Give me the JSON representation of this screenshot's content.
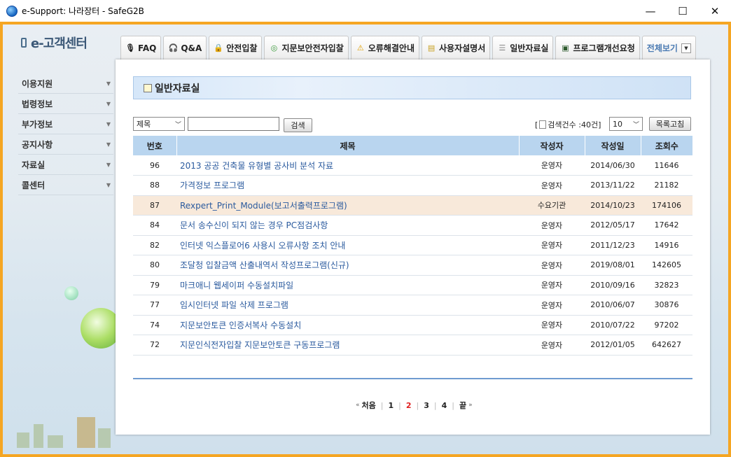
{
  "window": {
    "title": "e-Support: 나라장터 - SafeG2B",
    "minimize": "—",
    "maximize": "☐",
    "close": "✕"
  },
  "logo": {
    "text": "e-고객센터"
  },
  "sidebar": {
    "items": [
      {
        "label": "이용지원"
      },
      {
        "label": "법령정보"
      },
      {
        "label": "부가정보"
      },
      {
        "label": "공지사항"
      },
      {
        "label": "자료실"
      },
      {
        "label": "콜센터"
      }
    ]
  },
  "tabs": [
    {
      "label": "FAQ",
      "icon": "microphone-icon"
    },
    {
      "label": "Q&A",
      "icon": "headset-icon"
    },
    {
      "label": "안전입찰",
      "icon": "lock-icon"
    },
    {
      "label": "지문보안전자입찰",
      "icon": "fingerprint-icon"
    },
    {
      "label": "오류해결안내",
      "icon": "warning-icon"
    },
    {
      "label": "사용자설명서",
      "icon": "manual-icon"
    },
    {
      "label": "일반자료실",
      "icon": "database-icon"
    },
    {
      "label": "프로그램개선요청",
      "icon": "screen-icon"
    },
    {
      "label": "전체보기",
      "icon": "dropdown-icon"
    }
  ],
  "section": {
    "title": "일반자료실"
  },
  "search": {
    "field_value": "제목",
    "button_label": "검색",
    "count_prefix": "[",
    "count_text": "검색건수 :40건]",
    "page_size_value": "10",
    "refresh_label": "목록고침"
  },
  "table": {
    "headers": [
      "번호",
      "제목",
      "작성자",
      "작성일",
      "조회수"
    ],
    "rows": [
      {
        "no": "96",
        "title": "2013 공공 건축물 유형별 공사비 분석 자료",
        "author": "운영자",
        "date": "2014/06/30",
        "views": "11646"
      },
      {
        "no": "88",
        "title": "가격정보 프로그램",
        "author": "운영자",
        "date": "2013/11/22",
        "views": "21182"
      },
      {
        "no": "87",
        "title": "Rexpert_Print_Module(보고서출력프로그램)",
        "author": "수요기관",
        "date": "2014/10/23",
        "views": "174106"
      },
      {
        "no": "84",
        "title": "문서 송수신이 되지 않는 경우 PC점검사항",
        "author": "운영자",
        "date": "2012/05/17",
        "views": "17642"
      },
      {
        "no": "82",
        "title": "인터넷 익스플로어6 사용시 오류사항 조치 안내",
        "author": "운영자",
        "date": "2011/12/23",
        "views": "14916"
      },
      {
        "no": "80",
        "title": "조달청 입찰금액 산출내역서 작성프로그램(신규)",
        "author": "운영자",
        "date": "2019/08/01",
        "views": "142605"
      },
      {
        "no": "79",
        "title": "마크애니 웹세이퍼 수동설치파일",
        "author": "운영자",
        "date": "2010/09/16",
        "views": "32823"
      },
      {
        "no": "77",
        "title": "임시인터넷 파일 삭제 프로그램",
        "author": "운영자",
        "date": "2010/06/07",
        "views": "30876"
      },
      {
        "no": "74",
        "title": "지문보안토큰 인증서복사 수동설치",
        "author": "운영자",
        "date": "2010/07/22",
        "views": "97202"
      },
      {
        "no": "72",
        "title": "지문인식전자입찰 지문보안토큰 구동프로그램",
        "author": "운영자",
        "date": "2012/01/05",
        "views": "642627"
      }
    ]
  },
  "pagination": {
    "first": "처음",
    "pages": [
      "1",
      "2",
      "3",
      "4"
    ],
    "current": "2",
    "last": "끝"
  },
  "colors": {
    "frame": "#f5a623",
    "header_row": "#b9d5ef",
    "highlight_row": "#f8e9da",
    "link": "#2a5a9e",
    "current_page": "#e02020"
  }
}
